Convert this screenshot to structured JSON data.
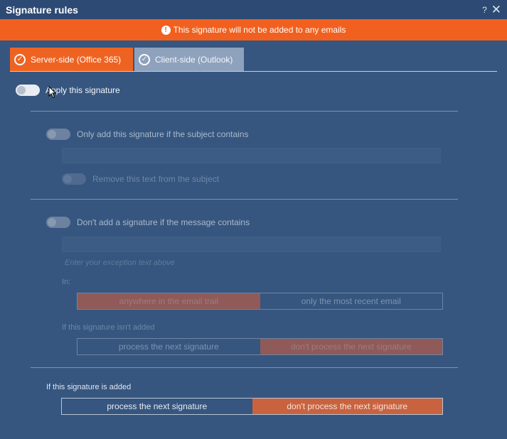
{
  "window": {
    "title": "Signature rules",
    "help_label": "?",
    "close_label": "✕"
  },
  "banner": {
    "text": "This signature will not be added to any emails",
    "icon": "warning-icon",
    "color": "#f1601f"
  },
  "tabs": [
    {
      "label": "Server-side (Office 365)",
      "selected": true
    },
    {
      "label": "Client-side (Outlook)",
      "selected": false
    }
  ],
  "apply": {
    "label": "Apply this signature",
    "on": false
  },
  "subject_rule": {
    "label": "Only add this signature if the subject contains",
    "on": false,
    "value": "",
    "remove_label": "Remove this text from the subject",
    "remove_on": false
  },
  "exception_rule": {
    "label": "Don't add a signature if the message contains",
    "on": false,
    "value": "",
    "hint": "Enter your exception text above",
    "in_label": "In:",
    "in_options": [
      "anywhere in the email trail",
      "only the most recent email"
    ],
    "in_selected": 0,
    "not_added_label": "If this signature isn't added",
    "not_added_options": [
      "process the next signature",
      "don't process the next signature"
    ],
    "not_added_selected": 1
  },
  "added_rule": {
    "label": "If this signature is added",
    "options": [
      "process the next signature",
      "don't process the next signature"
    ],
    "selected": 1
  },
  "colors": {
    "accent": "#ee6321",
    "background": "#36567f",
    "titlebar": "#2c4a73"
  }
}
